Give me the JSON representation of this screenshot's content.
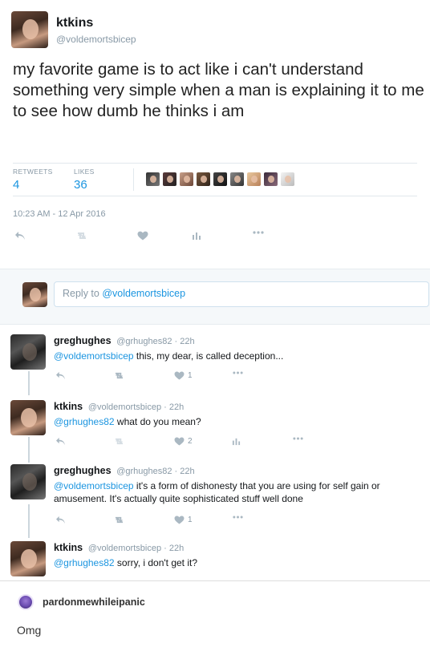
{
  "colors": {
    "link": "#1b95e0",
    "muted": "#8899a6",
    "action_icon": "#aab8c2"
  },
  "main_tweet": {
    "name": "ktkins",
    "handle": "@voldemortsbicep",
    "text": "my favorite game is to act like i can't understand something very simple when a man is explaining it to me to see how dumb he thinks i am",
    "retweets_label": "RETWEETS",
    "retweets": "4",
    "likes_label": "LIKES",
    "likes": "36",
    "timestamp": "10:23 AM - 12 Apr 2016",
    "icons": [
      "reply-icon",
      "retweet-icon",
      "heart-icon",
      "analytics-icon",
      "more-icon"
    ]
  },
  "reply_box": {
    "prefix": "Reply to ",
    "mention": "@voldemortsbicep"
  },
  "replies": [
    {
      "name": "greghughes",
      "meta": "@grhughes82 · 22h",
      "mention": "@voldemortsbicep",
      "text": " this, my dear, is called deception...",
      "likes": "1"
    },
    {
      "name": "ktkins",
      "meta": "@voldemortsbicep · 22h",
      "mention": "@grhughes82",
      "text": " what do you mean?",
      "likes": "2"
    },
    {
      "name": "greghughes",
      "meta": "@grhughes82 · 22h",
      "mention": "@voldemortsbicep",
      "text": " it's a form of dishonesty that you are using for self gain or amusement. It's actually quite sophisticated stuff well done",
      "likes": "1"
    },
    {
      "name": "ktkins",
      "meta": "@voldemortsbicep · 22h",
      "mention": "@grhughes82",
      "text": " sorry, i don't get it?"
    }
  ],
  "footer": {
    "username": "pardonmewhileipanic",
    "text": "Omg"
  }
}
